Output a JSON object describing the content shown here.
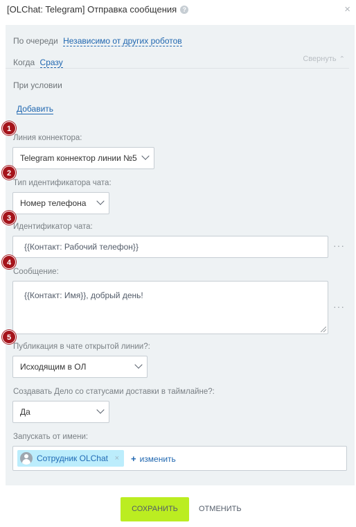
{
  "header": {
    "title": "[OLChat: Telegram] Отправка сообщения",
    "help_icon": "?",
    "close_icon": "×"
  },
  "params": {
    "queue_label": "По очереди",
    "queue_value": "Независимо от других роботов",
    "when_label": "Когда",
    "when_value": "Сразу",
    "condition_label": "При условии",
    "collapse_label": "Свернуть",
    "add_label": "Добавить"
  },
  "badges": [
    "1",
    "2",
    "3",
    "4",
    "5"
  ],
  "fields": {
    "connector_line": {
      "label": "Линия коннектора:",
      "value": "Telegram коннектор линии №5"
    },
    "chat_id_type": {
      "label": "Тип идентификатора чата:",
      "value": "Номер телефона"
    },
    "chat_id": {
      "label": "Идентификатор чата:",
      "value": "{{Контакт: Рабочий телефон}}"
    },
    "message": {
      "label": "Сообщение:",
      "value": "{{Контакт: Имя}}, добрый день!"
    },
    "publication": {
      "label": "Публикация в чате открытой линии?:",
      "value": "Исходящим в ОЛ"
    },
    "create_task": {
      "label": "Создавать Дело со статусами доставки в таймлайне?:",
      "value": "Да"
    },
    "run_as": {
      "label": "Запускать от имени:",
      "user": "Сотрудник OLChat",
      "change_label": "изменить"
    }
  },
  "more_icon": "···",
  "footer": {
    "save_label": "СОХРАНИТЬ",
    "cancel_label": "ОТМЕНИТЬ"
  }
}
